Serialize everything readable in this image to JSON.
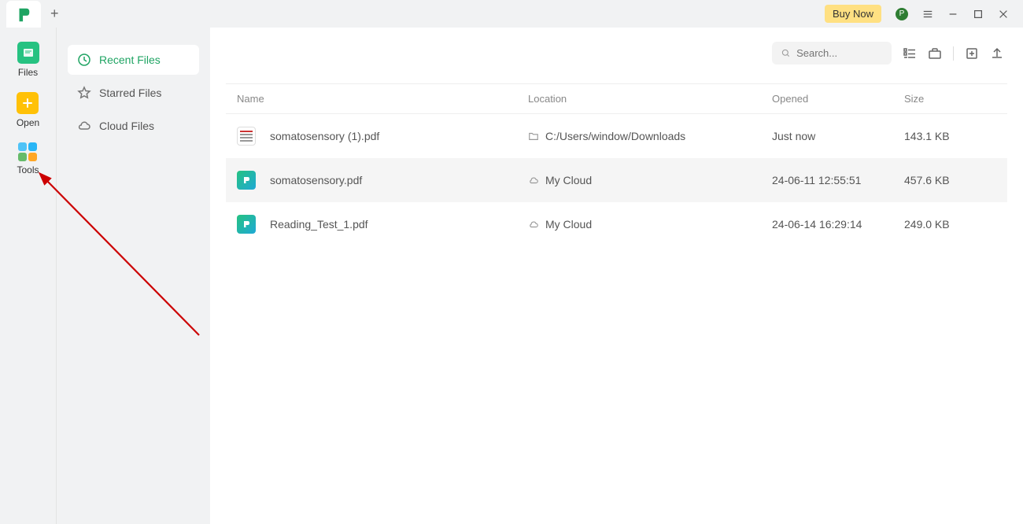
{
  "titlebar": {
    "buy_label": "Buy Now",
    "avatar_initial": "P"
  },
  "sidebar_left": [
    {
      "id": "files",
      "label": "Files"
    },
    {
      "id": "open",
      "label": "Open"
    },
    {
      "id": "tools",
      "label": "Tools"
    }
  ],
  "sidebar_mid": [
    {
      "id": "recent",
      "label": "Recent Files",
      "active": true
    },
    {
      "id": "starred",
      "label": "Starred Files",
      "active": false
    },
    {
      "id": "cloud",
      "label": "Cloud Files",
      "active": false
    }
  ],
  "toolbar": {
    "search_placeholder": "Search..."
  },
  "columns": {
    "name": "Name",
    "location": "Location",
    "opened": "Opened",
    "size": "Size"
  },
  "rows": [
    {
      "icon": "doc",
      "name": "somatosensory (1).pdf",
      "loc_type": "folder",
      "location": "C:/Users/window/Downloads",
      "opened": "Just now",
      "size": "143.1 KB",
      "highlight": false
    },
    {
      "icon": "app",
      "name": "somatosensory.pdf",
      "loc_type": "cloud",
      "location": "My Cloud",
      "opened": "24-06-11 12:55:51",
      "size": "457.6 KB",
      "highlight": true
    },
    {
      "icon": "app",
      "name": "Reading_Test_1.pdf",
      "loc_type": "cloud",
      "location": "My Cloud",
      "opened": "24-06-14 16:29:14",
      "size": "249.0 KB",
      "highlight": false
    }
  ]
}
